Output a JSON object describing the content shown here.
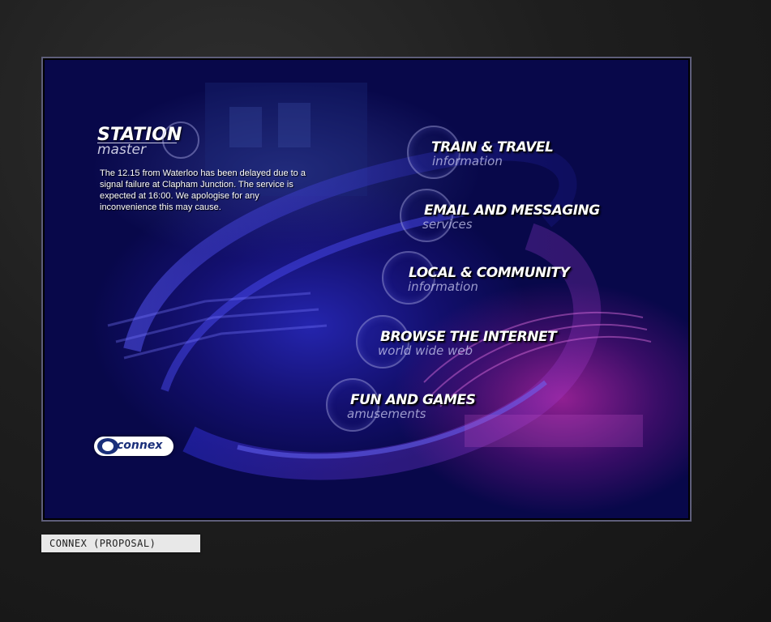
{
  "brand": {
    "title": "STATION",
    "subtitle": "master"
  },
  "notice": {
    "text": "The 12.15 from Waterloo has been delayed due to a signal failure at Clapham Junction. The service is expected at 16:00. We apologise for any inconvenience this may cause."
  },
  "menu": {
    "items": [
      {
        "title": "TRAIN & TRAVEL",
        "subtitle": "information"
      },
      {
        "title": "EMAIL AND MESSAGING",
        "subtitle": "services"
      },
      {
        "title": "LOCAL & COMMUNITY",
        "subtitle": "information"
      },
      {
        "title": "BROWSE THE INTERNET",
        "subtitle": "world wide web"
      },
      {
        "title": "FUN AND GAMES",
        "subtitle": "amusements"
      }
    ]
  },
  "logo": {
    "text": "connex"
  },
  "caption": {
    "text": "CONNEX (PROPOSAL)"
  },
  "colors": {
    "screen_bg": "#08084a",
    "accent_blue": "#3c3cff",
    "accent_magenta": "#be28aa",
    "frame": "#1c1c1c"
  }
}
